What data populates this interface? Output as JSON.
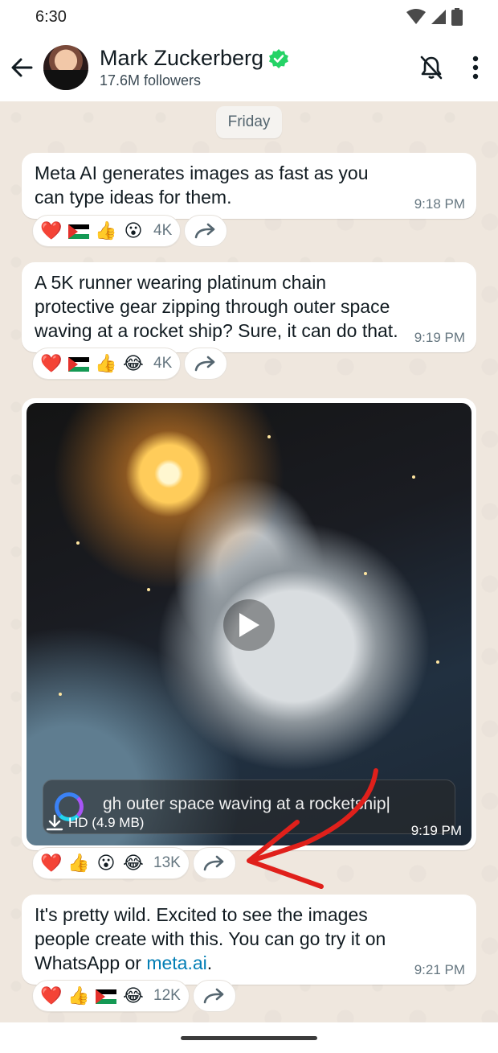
{
  "status_bar": {
    "time": "6:30"
  },
  "header": {
    "channel_name": "Mark Zuckerberg",
    "followers": "17.6M followers"
  },
  "chat": {
    "date_chip": "Friday",
    "messages": [
      {
        "text": "Meta AI generates images as fast as you can type ideas for them.",
        "time": "9:18 PM",
        "reactions": [
          "heart",
          "palestine-flag",
          "thumbs-up",
          "surprised"
        ],
        "reaction_count": "4K"
      },
      {
        "text": "A 5K runner wearing platinum chain protective gear zipping through outer space waving at a rocket ship? Sure, it can do that.",
        "time": "9:19 PM",
        "reactions": [
          "heart",
          "palestine-flag",
          "thumbs-up",
          "laughing"
        ],
        "reaction_count": "4K"
      },
      {
        "media_caption": "gh outer space waving at a rocketship|",
        "media_size": "HD (4.9 MB)",
        "time": "9:19 PM",
        "reactions": [
          "heart",
          "thumbs-up",
          "surprised",
          "laughing"
        ],
        "reaction_count": "13K"
      },
      {
        "text_before_link": "It's pretty wild. Excited to see the images people create with this. You can go try it on WhatsApp or ",
        "link_text": "meta.ai",
        "text_after_link": ".",
        "time": "9:21 PM",
        "reactions": [
          "heart",
          "thumbs-up",
          "palestine-flag",
          "laughing"
        ],
        "reaction_count": "12K"
      }
    ]
  },
  "emoji": {
    "heart": "❤️",
    "thumbs-up": "👍",
    "surprised": "😮",
    "laughing": "😂"
  },
  "colors": {
    "verified_badge": "#25d366",
    "link": "#027eb5",
    "annotation_arrow": "#e0201b",
    "chat_background": "#efe7de"
  }
}
